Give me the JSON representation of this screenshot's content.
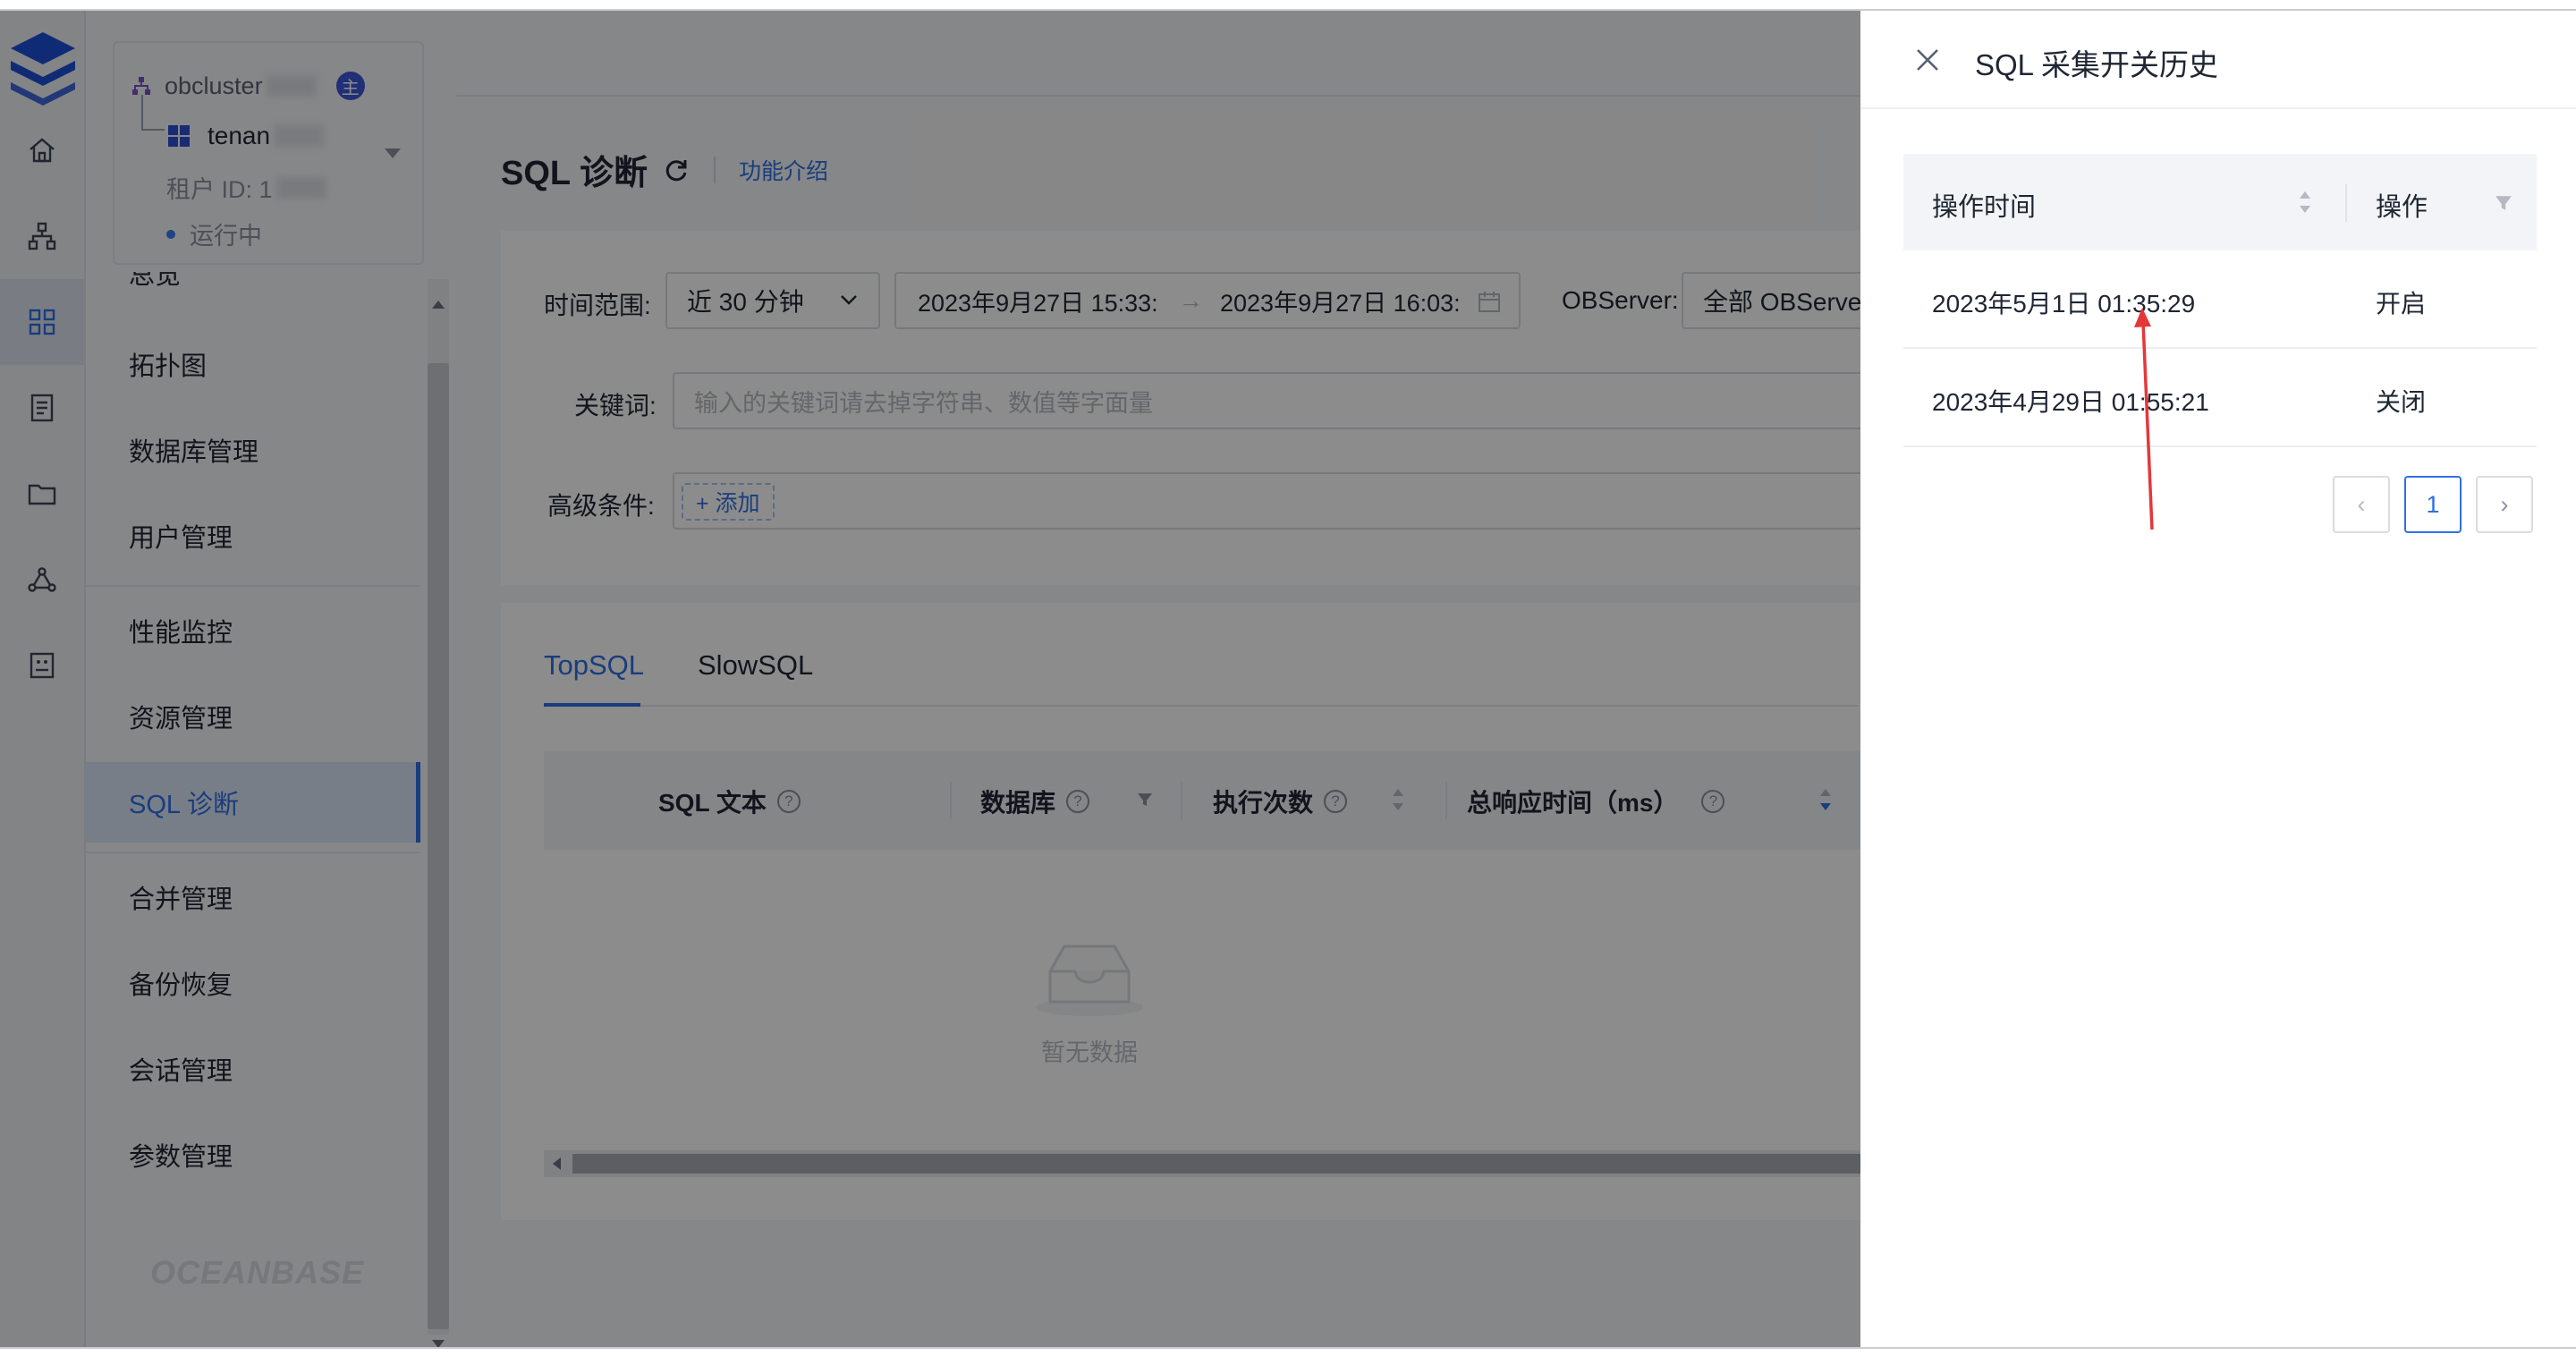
{
  "tenant_card": {
    "cluster": "obcluster",
    "main_badge": "主",
    "tenant": "tenan",
    "tenant_id_label": "租户 ID: 1",
    "status": "运行中"
  },
  "sidebar": {
    "cut_item": "总览",
    "items": [
      {
        "label": "拓扑图"
      },
      {
        "label": "数据库管理"
      },
      {
        "label": "用户管理"
      },
      {
        "label": "性能监控"
      },
      {
        "label": "资源管理"
      },
      {
        "label": "SQL 诊断"
      },
      {
        "label": "合并管理"
      },
      {
        "label": "备份恢复"
      },
      {
        "label": "会话管理"
      },
      {
        "label": "参数管理"
      }
    ],
    "watermark": "OCEANBASE"
  },
  "page": {
    "title": "SQL 诊断",
    "intro_link": "功能介绍"
  },
  "filters": {
    "time_range_label": "时间范围:",
    "time_range_value": "近 30 分钟",
    "range_start": "2023年9月27日 15:33:",
    "range_end": "2023年9月27日 16:03:",
    "range_arrow": "→",
    "observer_label": "OBServer:",
    "observer_value": "全部 OBServer",
    "keyword_label": "关键词:",
    "keyword_placeholder": "输入的关键词请去掉字符串、数值等字面量",
    "advanced_label": "高级条件:",
    "add_button": "+ 添加"
  },
  "result": {
    "tabs": [
      {
        "label": "TopSQL"
      },
      {
        "label": "SlowSQL"
      }
    ],
    "columns": [
      {
        "label": "SQL 文本"
      },
      {
        "label": "数据库"
      },
      {
        "label": "执行次数"
      },
      {
        "label": "总响应时间（ms）"
      }
    ],
    "help_glyph": "?",
    "empty_text": "暂无数据"
  },
  "drawer": {
    "title": "SQL 采集开关历史",
    "columns": {
      "time": "操作时间",
      "action": "操作"
    },
    "rows": [
      {
        "time": "2023年5月1日 01:35:29",
        "action": "开启"
      },
      {
        "time": "2023年4月29日 01:55:21",
        "action": "关闭"
      }
    ],
    "pagination": {
      "prev": "‹",
      "current": "1",
      "next": "›"
    }
  },
  "colors": {
    "primary": "#2f6fe4",
    "annotation_arrow": "#e5373a",
    "brand_logo": "#1e4fd8"
  }
}
